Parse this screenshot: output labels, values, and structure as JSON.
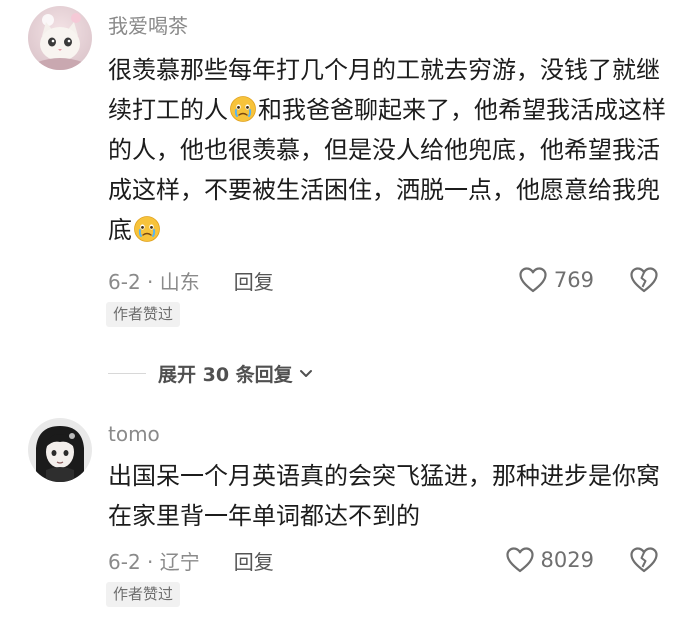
{
  "comments": [
    {
      "username": "我爱喝茶",
      "text_part1": "很羡慕那些每年打几个月的工就去穷游，没钱了就继续打工的人",
      "text_part2": "和我爸爸聊起来了，他希望我活成这样的人，他也很羡慕，但是没人给他兜底，他希望我活成这样，不要被生活困住，洒脱一点，他愿意给我兜底",
      "emoji": "crying-face-emoji",
      "date_location": "6-2 · 山东",
      "reply_label": "回复",
      "like_count": "769",
      "author_liked_badge": "作者赞过"
    },
    {
      "username": "tomo",
      "text": "出国呆一个月英语真的会突飞猛进，那种进步是你窝在家里背一年单词都达不到的",
      "date_location": "6-2 · 辽宁",
      "reply_label": "回复",
      "like_count": "8029",
      "author_liked_badge": "作者赞过"
    }
  ],
  "expand_replies": {
    "label": "展开 30 条回复",
    "icon": "chevron-down-icon"
  },
  "colors": {
    "meta_gray": "#8a8a8a",
    "badge_bg": "#f1f1f1",
    "text": "#1c1c1c"
  }
}
